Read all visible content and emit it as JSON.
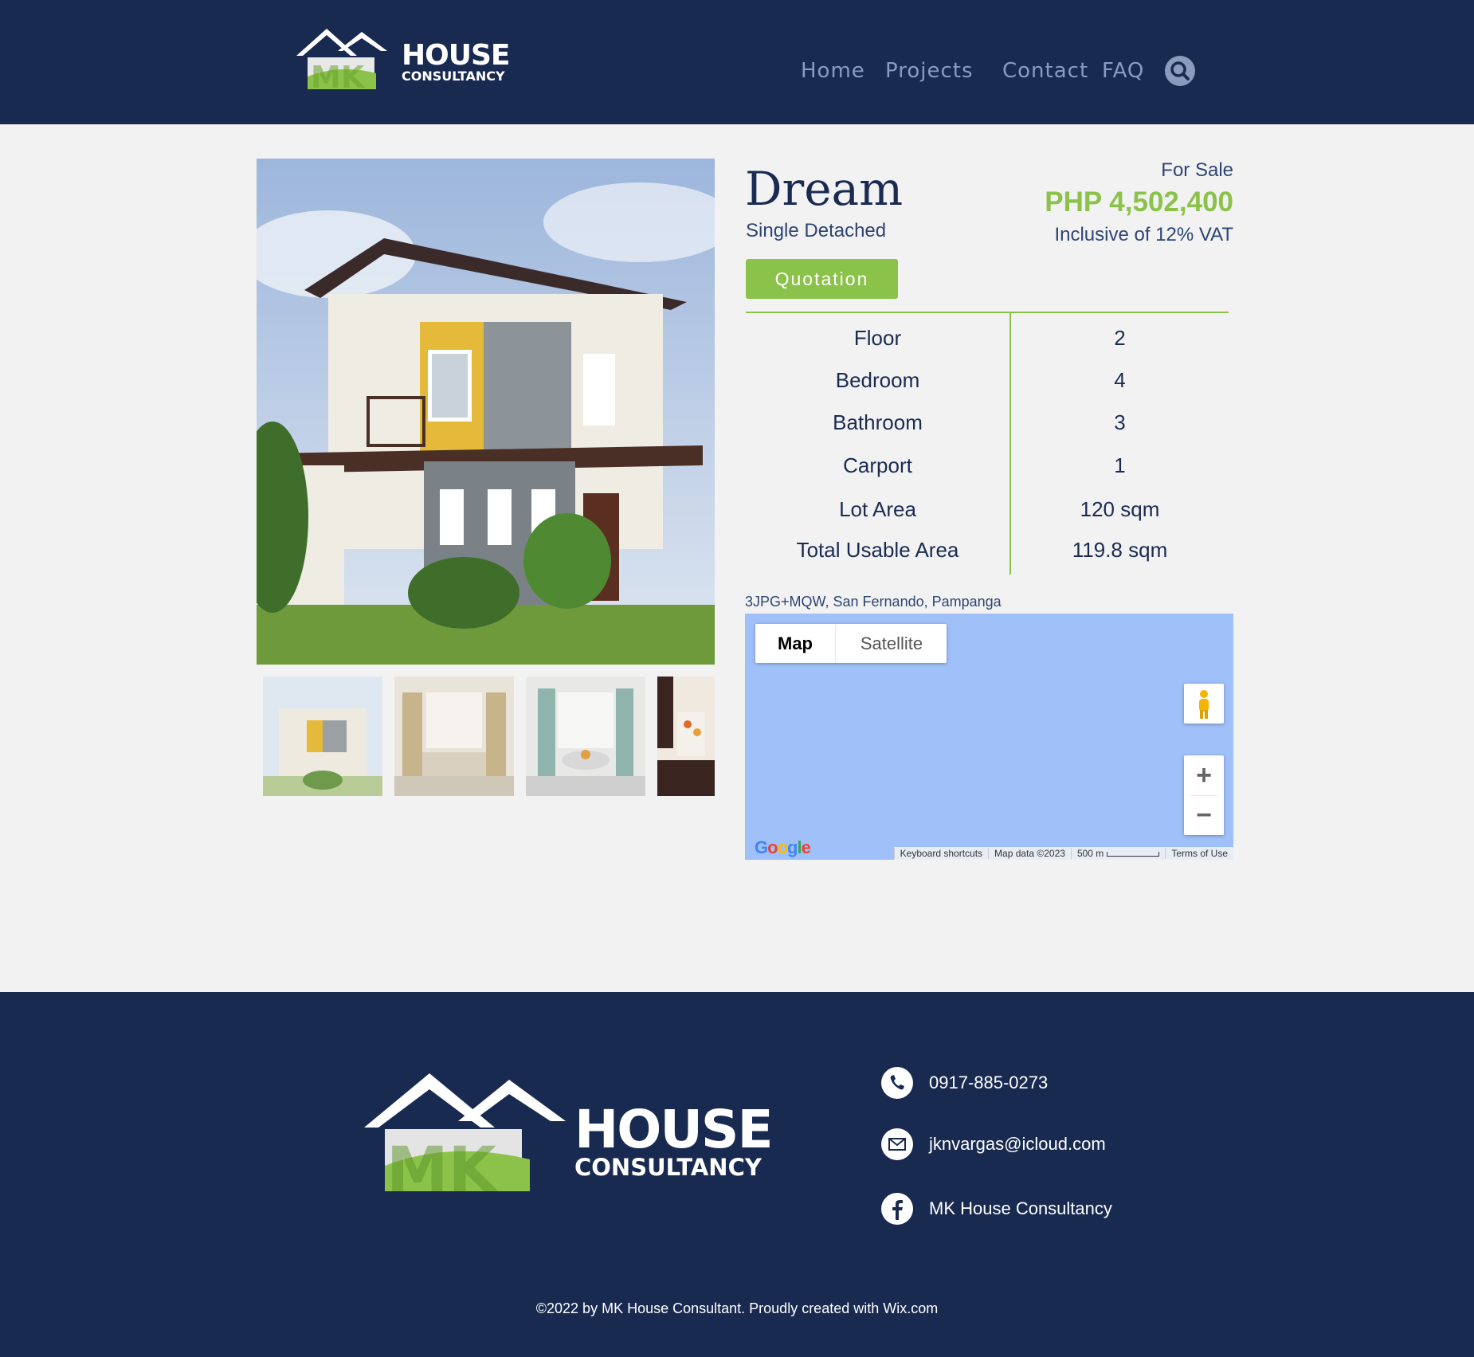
{
  "header": {
    "logo": {
      "big": "HOUSE",
      "small": "CONSULTANCY",
      "mark": "MK"
    },
    "nav": [
      {
        "label": "Home"
      },
      {
        "label": "Projects"
      },
      {
        "label": "Contact"
      },
      {
        "label": "FAQ"
      }
    ],
    "search_icon": "search-icon"
  },
  "property": {
    "name": "Dream",
    "type": "Single Detached",
    "status": "For Sale",
    "price": "PHP 4,502,400",
    "price_note": "Inclusive of 12% VAT",
    "quotation_label": "Quotation",
    "specs": [
      {
        "label": "Floor",
        "value": "2"
      },
      {
        "label": "Bedroom",
        "value": "4"
      },
      {
        "label": "Bathroom",
        "value": "3"
      },
      {
        "label": "Carport",
        "value": "1"
      },
      {
        "label": "Lot Area",
        "value": "120 sqm"
      },
      {
        "label": "Total Usable Area",
        "value": "119.8 sqm"
      }
    ],
    "address": "3JPG+MQW, San Fernando, Pampanga"
  },
  "map": {
    "tab_map": "Map",
    "tab_satellite": "Satellite",
    "zoom_in": "+",
    "zoom_out": "−",
    "brand": "Google",
    "footer": {
      "shortcuts": "Keyboard shortcuts",
      "data": "Map data ©2023",
      "scale": "500 m",
      "terms": "Terms of Use"
    }
  },
  "footer": {
    "logo": {
      "big": "HOUSE",
      "small": "CONSULTANCY",
      "mark": "MK"
    },
    "phone": "0917-885-0273",
    "email": "jknvargas@icloud.com",
    "facebook": "MK House Consultancy",
    "copyright": "©2022 by MK House Consultant. Proudly created with Wix.com"
  },
  "colors": {
    "navy": "#192a51",
    "accent": "#8bc34a",
    "map_water": "#9fc0f8"
  }
}
